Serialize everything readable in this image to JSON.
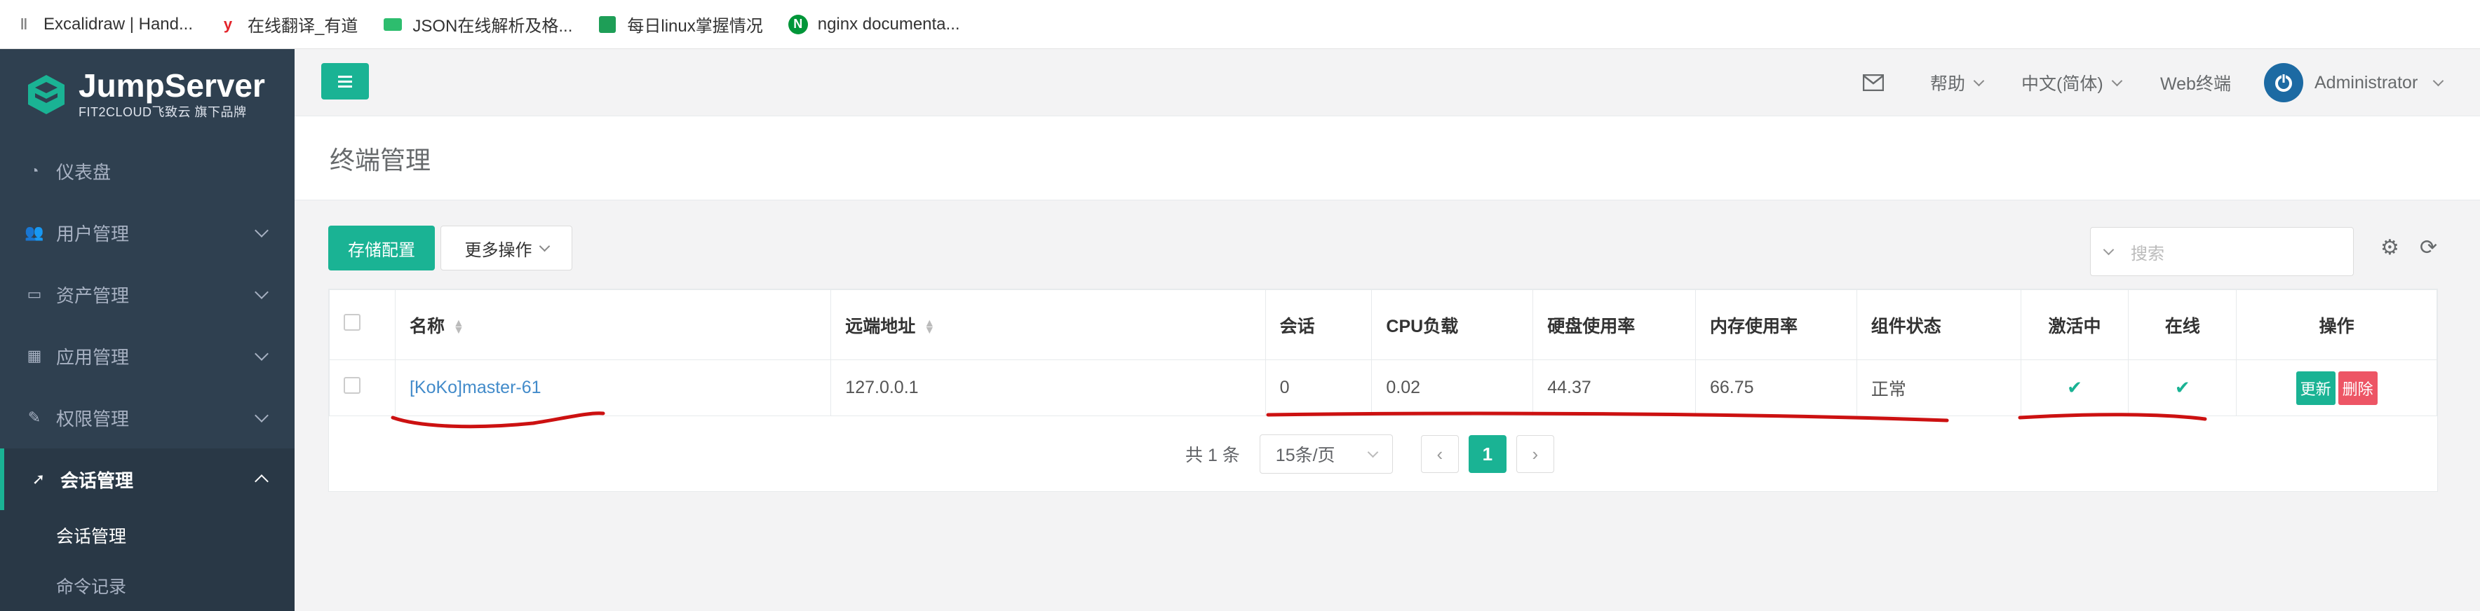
{
  "bookmarks": [
    {
      "icon": "feather-icon",
      "label": "Excalidraw | Hand..."
    },
    {
      "icon": "youdao-icon",
      "label": "在线翻译_有道"
    },
    {
      "icon": "json-icon",
      "label": "JSON在线解析及格..."
    },
    {
      "icon": "sheet-icon",
      "label": "每日linux掌握情况"
    },
    {
      "icon": "nginx-icon",
      "label": "nginx documenta..."
    }
  ],
  "brand": {
    "title": "JumpServer",
    "subtitle": "FIT2CLOUD飞致云 旗下品牌",
    "accent": "#1ab394"
  },
  "nav": {
    "items": [
      {
        "label": "仪表盘",
        "icon": "dashboard-icon"
      },
      {
        "label": "用户管理",
        "icon": "users-icon"
      },
      {
        "label": "资产管理",
        "icon": "hdd-icon"
      },
      {
        "label": "应用管理",
        "icon": "grid-icon"
      },
      {
        "label": "权限管理",
        "icon": "edit-icon"
      },
      {
        "label": "会话管理",
        "icon": "rocket-icon"
      }
    ],
    "sub_items": [
      "会话管理",
      "命令记录"
    ]
  },
  "header": {
    "help": "帮助",
    "language": "中文(简体)",
    "web_terminal": "Web终端",
    "user": "Administrator"
  },
  "page": {
    "title": "终端管理"
  },
  "toolbar": {
    "storage_config": "存储配置",
    "more_actions": "更多操作",
    "search_placeholder": "搜索"
  },
  "table": {
    "columns": [
      "名称",
      "远端地址",
      "会话",
      "CPU负载",
      "硬盘使用率",
      "内存使用率",
      "组件状态",
      "激活中",
      "在线",
      "操作"
    ],
    "rows": [
      {
        "name": "[KoKo]master-61",
        "address": "127.0.0.1",
        "sessions": "0",
        "cpu": "0.02",
        "disk": "44.37",
        "memory": "66.75",
        "status": "正常",
        "update": "更新",
        "delete": "删除"
      }
    ]
  },
  "pagination": {
    "total": "共 1 条",
    "page_size": "15条/页",
    "current": "1"
  }
}
